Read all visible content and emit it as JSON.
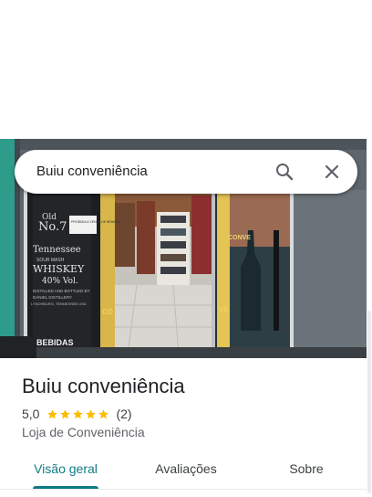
{
  "search": {
    "query": "Buiu conveniência",
    "search_icon": "search-icon",
    "close_icon": "close-icon"
  },
  "photo": {
    "description_icon": "storefront-photo",
    "left_panel": {
      "line1": "Old",
      "line2": "No.7",
      "line3": "Tennessee",
      "line4": "SOUR MASH",
      "line5": "WHISKEY",
      "line6": "40% Vol.",
      "line7": "DISTILLED AND BOTTLED BY",
      "line8": "DANIEL DISTILLERY",
      "line9": "LYNCHBURG, TENNESSEE USA",
      "line10": "BEBIDAS",
      "sign": "PROIBIDA A VENDA DE BEBIDAS"
    },
    "right_panel": {
      "line1": "CONVE",
      "line2": "VE"
    },
    "mid_panel": {
      "line1": "CO"
    }
  },
  "place": {
    "title": "Buiu conveniência",
    "rating": "5,0",
    "stars": 5,
    "review_count": "(2)",
    "category": "Loja de Conveniência"
  },
  "tabs": [
    {
      "label": "Visão geral",
      "active": true
    },
    {
      "label": "Avaliações",
      "active": false
    },
    {
      "label": "Sobre",
      "active": false
    }
  ],
  "colors": {
    "accent": "#0f7b83",
    "star": "#fbbc04",
    "text": "#202124",
    "muted": "#5f6368"
  }
}
